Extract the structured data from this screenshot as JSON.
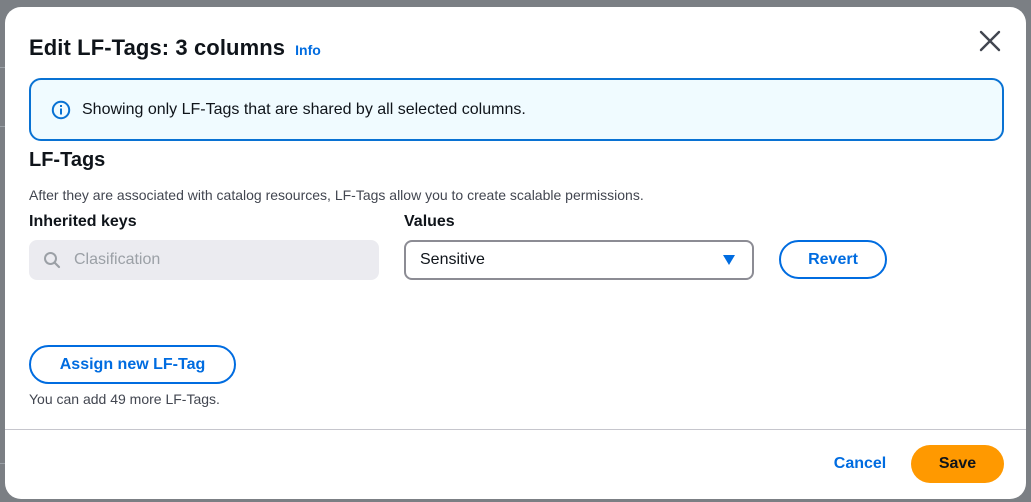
{
  "modal": {
    "title": "Edit LF-Tags: 3 columns",
    "info_link": "Info",
    "close_icon": "close-icon"
  },
  "alert": {
    "icon": "info-circle-icon",
    "text": "Showing only LF-Tags that are shared by all selected columns.",
    "border_color": "#0972d3",
    "background_color": "#f0fbff"
  },
  "lf_tags": {
    "title": "LF-Tags",
    "description": "After they are associated with catalog resources, LF-Tags allow you to create scalable permissions.",
    "inherited_keys_label": "Inherited keys",
    "values_label": "Values",
    "rows": [
      {
        "key_placeholder": "Clasification",
        "value_selected": "Sensitive",
        "revert_label": "Revert"
      }
    ],
    "assign_button": "Assign new LF-Tag",
    "helper_text": "You can add 49 more LF-Tags."
  },
  "footer": {
    "cancel_label": "Cancel",
    "save_label": "Save"
  },
  "colors": {
    "link_blue": "#006ce0",
    "primary_orange": "#ff9900",
    "text_dark": "#0f141a"
  }
}
